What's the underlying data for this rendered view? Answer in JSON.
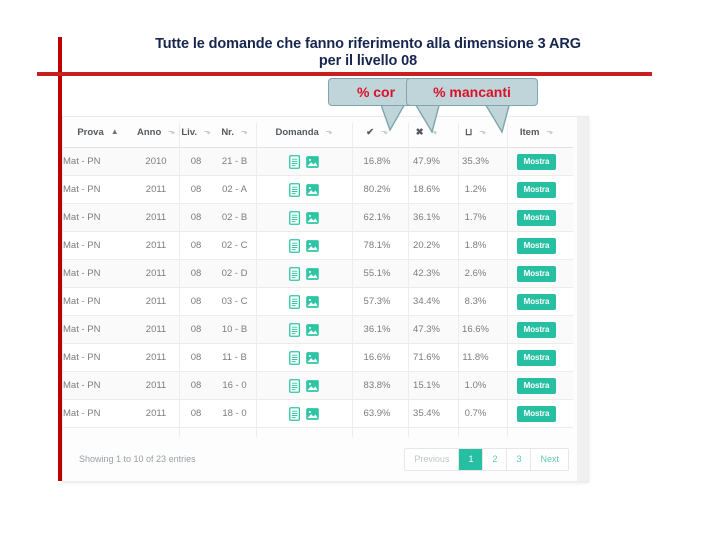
{
  "slide": {
    "title_line1": "Tutte le domande che fanno riferimento alla dimensione 3 ARG",
    "title_line2": "per il livello 08",
    "accent_red": "#C82020",
    "title_color": "#17264F"
  },
  "callouts": [
    {
      "id": "corrette",
      "label": "% corrette",
      "visible_label": "% cor",
      "fill": "#BFD5DA",
      "border": "#7FA5AC",
      "text_color": "#D8122A"
    },
    {
      "id": "mancanti",
      "label": "% mancanti",
      "visible_label": "% mancanti",
      "fill": "#BFD5DA",
      "border": "#7FA5AC",
      "text_color": "#D8122A"
    }
  ],
  "table": {
    "columns": [
      {
        "key": "prova",
        "label": "Prova",
        "sort": "asc"
      },
      {
        "key": "anno",
        "label": "Anno",
        "sort": "none"
      },
      {
        "key": "liv",
        "label": "Liv.",
        "sort": "none"
      },
      {
        "key": "nr",
        "label": "Nr.",
        "sort": "none"
      },
      {
        "key": "domanda",
        "label": "Domanda",
        "sort": "none"
      },
      {
        "key": "corrette",
        "label": "✔",
        "sort": "none"
      },
      {
        "key": "errate",
        "label": "✖",
        "sort": "none"
      },
      {
        "key": "mancanti",
        "label": "⊔",
        "sort": "none"
      },
      {
        "key": "item",
        "label": "Item",
        "sort": "none"
      }
    ],
    "rows": [
      {
        "prova": "Mat - PN",
        "anno": "2010",
        "liv": "08",
        "nr": "21 - B",
        "corrette": "16.8%",
        "errate": "47.9%",
        "mancanti": "35.3%",
        "item": "Mostra"
      },
      {
        "prova": "Mat - PN",
        "anno": "2011",
        "liv": "08",
        "nr": "02 - A",
        "corrette": "80.2%",
        "errate": "18.6%",
        "mancanti": "1.2%",
        "item": "Mostra"
      },
      {
        "prova": "Mat - PN",
        "anno": "2011",
        "liv": "08",
        "nr": "02 - B",
        "corrette": "62.1%",
        "errate": "36.1%",
        "mancanti": "1.7%",
        "item": "Mostra"
      },
      {
        "prova": "Mat - PN",
        "anno": "2011",
        "liv": "08",
        "nr": "02 - C",
        "corrette": "78.1%",
        "errate": "20.2%",
        "mancanti": "1.8%",
        "item": "Mostra"
      },
      {
        "prova": "Mat - PN",
        "anno": "2011",
        "liv": "08",
        "nr": "02 - D",
        "corrette": "55.1%",
        "errate": "42.3%",
        "mancanti": "2.6%",
        "item": "Mostra"
      },
      {
        "prova": "Mat - PN",
        "anno": "2011",
        "liv": "08",
        "nr": "03 - C",
        "corrette": "57.3%",
        "errate": "34.4%",
        "mancanti": "8.3%",
        "item": "Mostra"
      },
      {
        "prova": "Mat - PN",
        "anno": "2011",
        "liv": "08",
        "nr": "10 - B",
        "corrette": "36.1%",
        "errate": "47.3%",
        "mancanti": "16.6%",
        "item": "Mostra"
      },
      {
        "prova": "Mat - PN",
        "anno": "2011",
        "liv": "08",
        "nr": "11 - B",
        "corrette": "16.6%",
        "errate": "71.6%",
        "mancanti": "11.8%",
        "item": "Mostra"
      },
      {
        "prova": "Mat - PN",
        "anno": "2011",
        "liv": "08",
        "nr": "16 - 0",
        "corrette": "83.8%",
        "errate": "15.1%",
        "mancanti": "1.0%",
        "item": "Mostra"
      },
      {
        "prova": "Mat - PN",
        "anno": "2011",
        "liv": "08",
        "nr": "18 - 0",
        "corrette": "63.9%",
        "errate": "35.4%",
        "mancanti": "0.7%",
        "item": "Mostra"
      }
    ],
    "row_icons": {
      "document": "document-icon",
      "image": "image-icon"
    },
    "accent": "#27BFA1"
  },
  "footer": {
    "info": "Showing 1 to 10 of 23 entries",
    "pagination": [
      {
        "label": "Previous",
        "state": "muted"
      },
      {
        "label": "1",
        "state": "active"
      },
      {
        "label": "2",
        "state": "normal"
      },
      {
        "label": "3",
        "state": "normal"
      },
      {
        "label": "Next",
        "state": "normal"
      }
    ]
  }
}
